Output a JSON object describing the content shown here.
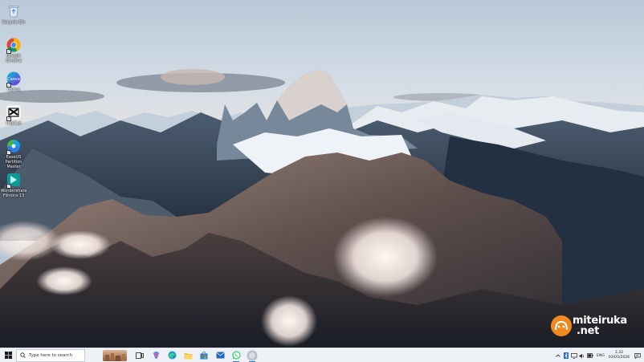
{
  "desktop": {
    "icons": [
      {
        "label": "Recycle Bin",
        "icon": "recycle-bin-icon"
      },
      {
        "label": "Google Chrome",
        "icon": "chrome-icon"
      },
      {
        "label": "Canva",
        "icon": "canva-icon"
      },
      {
        "label": "CapCut",
        "icon": "capcut-icon"
      },
      {
        "label": "EaseUS Partition Master",
        "icon": "easeus-icon"
      },
      {
        "label": "Wondershare Filmora 13",
        "icon": "filmora-icon"
      }
    ]
  },
  "watermark": {
    "line1": "miteiruka",
    "line2": ".net"
  },
  "taskbar": {
    "search_placeholder": "Type here to search",
    "apps": [
      "task-view-icon",
      "copilot-icon",
      "edge-icon",
      "file-explorer-icon",
      "store-icon",
      "mail-icon",
      "whatsapp-icon",
      "app-icon"
    ],
    "tray": {
      "language": "ENG",
      "time": "1:32",
      "date": "03/05/2026"
    }
  },
  "colors": {
    "taskbar_bg": "#eef1f5",
    "accent": "#3a7bd5",
    "watermark_orange": "#f08a1e"
  }
}
